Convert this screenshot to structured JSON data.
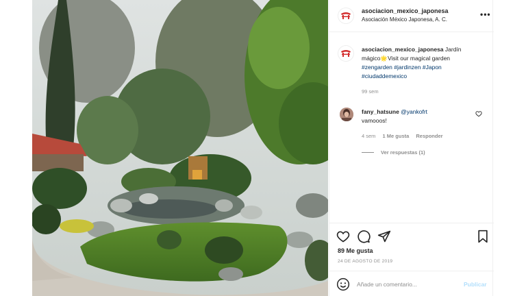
{
  "post": {
    "account": "asociacion_mexico_japonesa",
    "location": "Asociación México Japonesa, A. C.",
    "more_icon": "more-horizontal-icon"
  },
  "caption": {
    "user": "asociacion_mexico_japonesa",
    "text_before": "Jardín mágico",
    "emoji": "🌟",
    "text_after": "Visit our magical garden",
    "tags": [
      "#zengarden",
      "#jardinzen",
      "#Japon",
      "#ciudaddemexico"
    ],
    "time": "99 sem"
  },
  "comment": {
    "user": "fany_hatsune",
    "mention": "@yankofrt",
    "text": "vamooos!",
    "time": "4 sem",
    "likes": "1 Me gusta",
    "reply": "Responder",
    "view_replies": "Ver respuestas (1)"
  },
  "actions": {
    "likes_count": "89 Me gusta",
    "date": "24 DE AGOSTO DE 2019"
  },
  "compose": {
    "placeholder": "Añade un comentario...",
    "publish": "Publicar"
  },
  "colors": {
    "brand_red": "#d32f2f",
    "link_blue": "#00376b",
    "muted": "#8e8e8e",
    "publish_disabled": "#b2dffc"
  }
}
